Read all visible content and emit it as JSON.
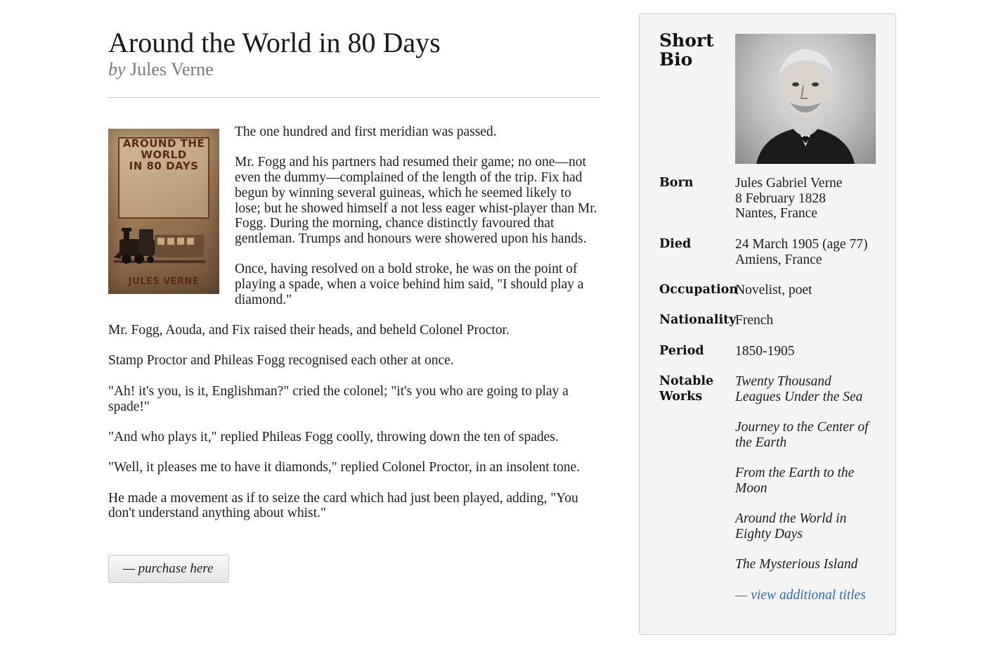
{
  "book": {
    "title": "Around the World in 80 Days",
    "by": "by",
    "author": "Jules Verne",
    "cover": {
      "title_text": "AROUND THE\nWORLD\nIN 80 DAYS",
      "author_text": "JULES VERNE"
    }
  },
  "excerpt": [
    "The one hundred and first meridian was passed.",
    "Mr. Fogg and his partners had resumed their game; no one—not even the dummy—complained of the length of the trip. Fix had begun by winning several guineas, which he seemed likely to lose; but he showed himself a not less eager whist-player than Mr. Fogg. During the morning, chance distinctly favoured that gentleman. Trumps and honours were showered upon his hands.",
    "Once, having resolved on a bold stroke, he was on the point of playing a spade, when a voice behind him said, \"I should play a diamond.\"",
    "Mr. Fogg, Aouda, and Fix raised their heads, and beheld Colonel Proctor.",
    "Stamp Proctor and Phileas Fogg recognised each other at once.",
    "\"Ah! it's you, is it, Englishman?\" cried the colonel; \"it's you who are going to play a spade!\"",
    "\"And who plays it,\" replied Phileas Fogg coolly, throwing down the ten of spades.",
    "\"Well, it pleases me to have it diamonds,\" replied Colonel Proctor, in an insolent tone.",
    "He made a movement as if to seize the card which had just been played, adding, \"You don't understand anything about whist.\""
  ],
  "purchase_label": "— purchase here",
  "bio": {
    "heading": "Short\nBio",
    "born_label": "Born",
    "born_name": "Jules Gabriel Verne",
    "born_date": "8 February 1828",
    "born_place": "Nantes, France",
    "died_label": "Died",
    "died_date": "24 March 1905 (age 77)",
    "died_place": "Amiens, France",
    "occupation_label": "Occupation",
    "occupation": "Novelist, poet",
    "nationality_label": "Nationality",
    "nationality": "French",
    "period_label": "Period",
    "period": "1850-1905",
    "notable_label": "Notable\nWorks",
    "works": [
      "Twenty Thousand Leagues Under the Sea",
      "Journey to the Center of the Earth",
      "From the Earth to the Moon",
      "Around the World in Eighty Days",
      "The Mysterious Island"
    ],
    "more_label": "— view additional titles",
    "link_color": "#2a6cc4"
  }
}
